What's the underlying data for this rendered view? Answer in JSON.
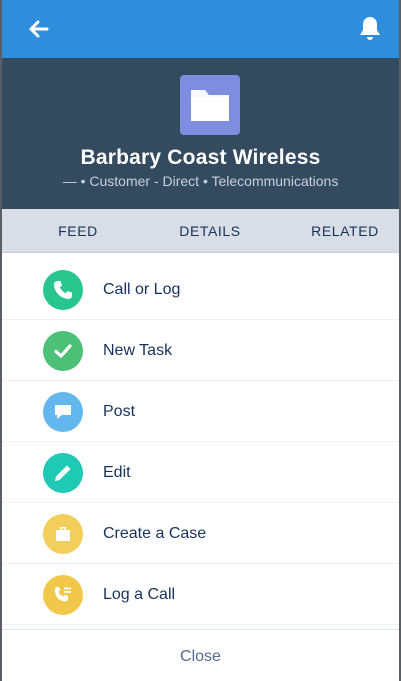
{
  "header": {
    "title": "Barbary Coast Wireless",
    "subtitle": "— • Customer - Direct • Telecommunications",
    "icon": "folder-icon"
  },
  "tabs": [
    {
      "label": "FEED"
    },
    {
      "label": "DETAILS"
    },
    {
      "label": "RELATED"
    }
  ],
  "actions": [
    {
      "label": "Call or Log",
      "icon": "phone-icon",
      "color": "#29c58f"
    },
    {
      "label": "New Task",
      "icon": "check-icon",
      "color": "#4bc076"
    },
    {
      "label": "Post",
      "icon": "chat-bubble-icon",
      "color": "#62b7ed"
    },
    {
      "label": "Edit",
      "icon": "pencil-icon",
      "color": "#1fc9b3"
    },
    {
      "label": "Create a Case",
      "icon": "briefcase-icon",
      "color": "#f2cf5b"
    },
    {
      "label": "Log a Call",
      "icon": "log-call-icon",
      "color": "#f1c84b"
    }
  ],
  "footer": {
    "close_label": "Close"
  },
  "colors": {
    "topbar": "#2f8fdd",
    "header": "#344a5f",
    "tabs": "#d8dde6",
    "record_icon": "#7f8de1"
  }
}
